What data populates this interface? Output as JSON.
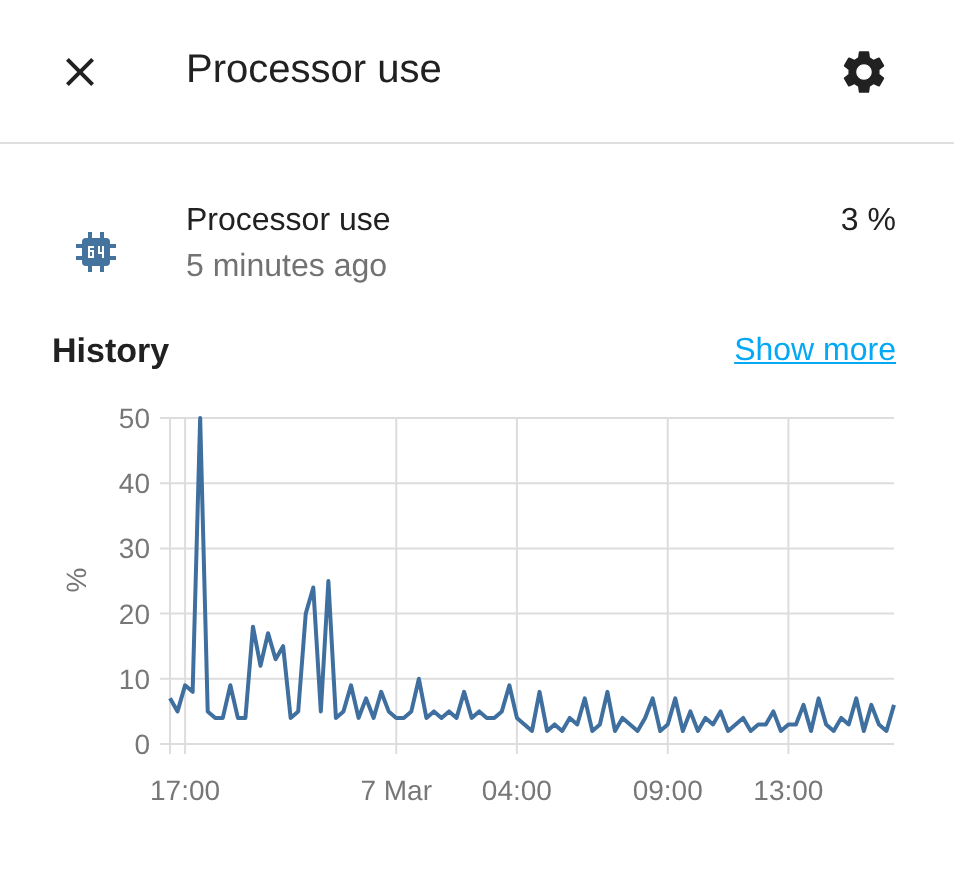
{
  "dialog": {
    "title": "Processor use"
  },
  "entity": {
    "name": "Processor use",
    "updated": "5 minutes ago",
    "value": "3 %"
  },
  "history": {
    "title": "History",
    "link": "Show more",
    "chart_data": {
      "type": "line",
      "grid": true,
      "ylabel": "%",
      "ylim": [
        0,
        50
      ],
      "yticks": [
        0,
        10,
        20,
        30,
        40,
        50
      ],
      "categories": [
        null,
        null,
        "17:00",
        null,
        null,
        null,
        null,
        null,
        null,
        null,
        null,
        null,
        null,
        null,
        null,
        null,
        null,
        null,
        null,
        null,
        null,
        null,
        null,
        null,
        null,
        null,
        null,
        null,
        null,
        null,
        "7 Mar",
        null,
        null,
        null,
        null,
        null,
        null,
        null,
        null,
        null,
        null,
        null,
        null,
        null,
        null,
        null,
        "04:00",
        null,
        null,
        null,
        null,
        null,
        null,
        null,
        null,
        null,
        null,
        null,
        null,
        null,
        null,
        null,
        null,
        null,
        null,
        null,
        "09:00",
        null,
        null,
        null,
        null,
        null,
        null,
        null,
        null,
        null,
        null,
        null,
        null,
        null,
        null,
        null,
        "13:00",
        null,
        null,
        null,
        null,
        null,
        null,
        null,
        null,
        null,
        null,
        null,
        null,
        null,
        null
      ],
      "series": [
        {
          "color": "#3f6f9f",
          "values": [
            7,
            5,
            9,
            8,
            50,
            5,
            4,
            4,
            9,
            4,
            4,
            18,
            12,
            17,
            13,
            15,
            4,
            5,
            20,
            24,
            5,
            25,
            4,
            5,
            9,
            4,
            7,
            4,
            8,
            5,
            4,
            4,
            5,
            10,
            4,
            5,
            4,
            5,
            4,
            8,
            4,
            5,
            4,
            4,
            5,
            9,
            4,
            3,
            2,
            8,
            2,
            3,
            2,
            4,
            3,
            7,
            2,
            3,
            8,
            2,
            4,
            3,
            2,
            4,
            7,
            2,
            3,
            7,
            2,
            5,
            2,
            4,
            3,
            5,
            2,
            3,
            4,
            2,
            3,
            3,
            5,
            2,
            3,
            3,
            6,
            2,
            7,
            3,
            2,
            4,
            3,
            7,
            2,
            6,
            3,
            2,
            6
          ]
        }
      ]
    }
  }
}
